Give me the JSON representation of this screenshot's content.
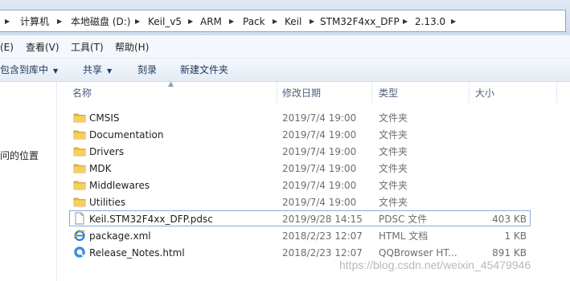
{
  "address_bar": {
    "breadcrumbs": [
      "计算机",
      "本地磁盘 (D:)",
      "Keil_v5",
      "ARM",
      "Pack",
      "Keil",
      "STM32F4xx_DFP",
      "2.13.0"
    ]
  },
  "menu": {
    "items": [
      "(E)",
      "查看(V)",
      "工具(T)",
      "帮助(H)"
    ]
  },
  "toolbar": {
    "include_in_library": "包含到库中",
    "share": "共享",
    "burn": "刻录",
    "new_folder": "新建文件夹"
  },
  "nav": {
    "recent_places": "问的位置"
  },
  "columns": {
    "name": "名称",
    "date": "修改日期",
    "type": "类型",
    "size": "大小"
  },
  "files": [
    {
      "name": "CMSIS",
      "date": "2019/7/4 19:00",
      "type": "文件夹",
      "size": "",
      "icon": "folder-icon"
    },
    {
      "name": "Documentation",
      "date": "2019/7/4 19:00",
      "type": "文件夹",
      "size": "",
      "icon": "folder-icon"
    },
    {
      "name": "Drivers",
      "date": "2019/7/4 19:00",
      "type": "文件夹",
      "size": "",
      "icon": "folder-icon"
    },
    {
      "name": "MDK",
      "date": "2019/7/4 19:00",
      "type": "文件夹",
      "size": "",
      "icon": "folder-icon"
    },
    {
      "name": "Middlewares",
      "date": "2019/7/4 19:00",
      "type": "文件夹",
      "size": "",
      "icon": "folder-icon"
    },
    {
      "name": "Utilities",
      "date": "2019/7/4 19:00",
      "type": "文件夹",
      "size": "",
      "icon": "folder-icon"
    },
    {
      "name": "Keil.STM32F4xx_DFP.pdsc",
      "date": "2019/9/28 14:15",
      "type": "PDSC 文件",
      "size": "403 KB",
      "icon": "document-icon"
    },
    {
      "name": "package.xml",
      "date": "2018/2/23 12:07",
      "type": "HTML 文档",
      "size": "1 KB",
      "icon": "ie-icon"
    },
    {
      "name": "Release_Notes.html",
      "date": "2018/2/23 12:07",
      "type": "QQBrowser HT...",
      "size": "891 KB",
      "icon": "qqbrowser-icon"
    }
  ],
  "watermark": "https://blog.csdn.net/weixin_45479946",
  "colors": {
    "folder": "#e8b73e",
    "selection_border": "#84acdd",
    "header_text": "#4c607a"
  }
}
